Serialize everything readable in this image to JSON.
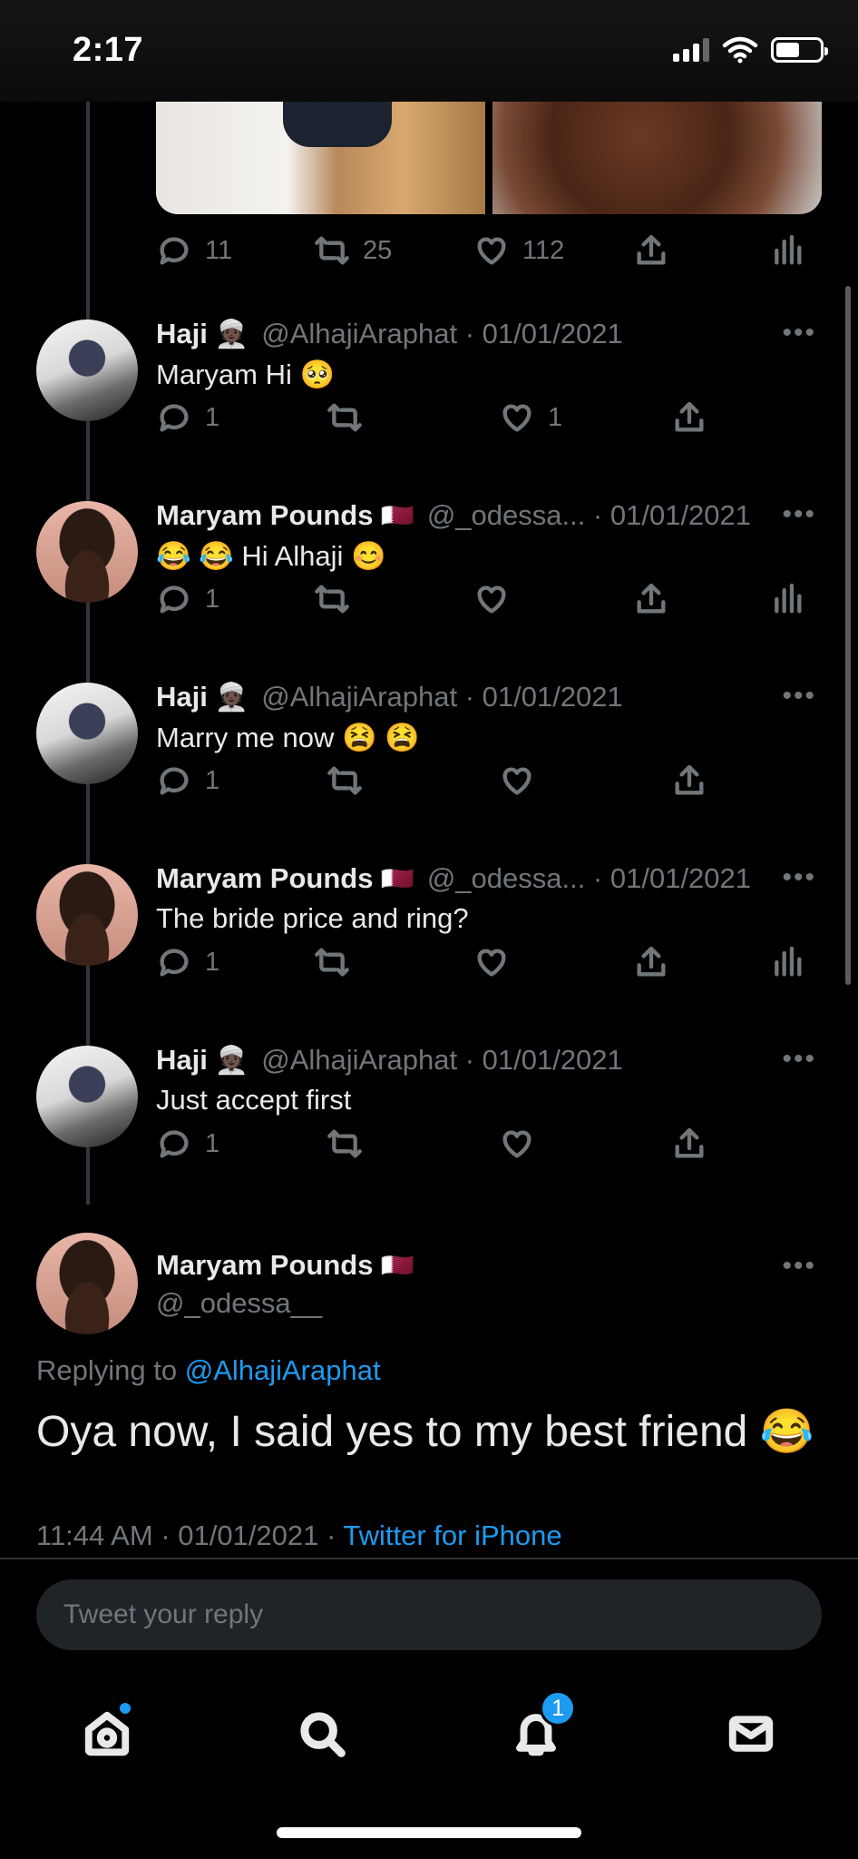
{
  "status_bar": {
    "time": "2:17",
    "battery_level": 0.55
  },
  "top_tweet_actions": {
    "replies": "11",
    "retweets": "25",
    "likes": "112"
  },
  "thread": [
    {
      "name": "Haji",
      "emoji": "👳🏿",
      "handle": "@AlhajiAraphat · 01/01/2021",
      "text": "Maryam Hi 🥺",
      "replies": "1",
      "retweets": "",
      "likes": "1",
      "avatar": "haji"
    },
    {
      "name": "Maryam Pounds",
      "emoji": "🇶🇦",
      "handle": "@_odessa... · 01/01/2021",
      "text": "😂 😂 Hi Alhaji 😊",
      "replies": "1",
      "retweets": "",
      "likes": "",
      "avatar": "maryam"
    },
    {
      "name": "Haji",
      "emoji": "👳🏿",
      "handle": "@AlhajiAraphat · 01/01/2021",
      "text": "Marry me now 😫 😫",
      "replies": "1",
      "retweets": "",
      "likes": "",
      "avatar": "haji"
    },
    {
      "name": "Maryam Pounds",
      "emoji": "🇶🇦",
      "handle": "@_odessa... · 01/01/2021",
      "text": "The bride price and ring?",
      "replies": "1",
      "retweets": "",
      "likes": "",
      "avatar": "maryam"
    },
    {
      "name": "Haji",
      "emoji": "👳🏿",
      "handle": "@AlhajiAraphat · 01/01/2021",
      "text": "Just accept first",
      "replies": "1",
      "retweets": "",
      "likes": "",
      "avatar": "haji"
    }
  ],
  "focus_tweet": {
    "name": "Maryam Pounds",
    "emoji": "🇶🇦",
    "handle": "@_odessa__",
    "replying_prefix": "Replying to",
    "replying_to": "@AlhajiAraphat",
    "text": "Oya now, I said yes to my best friend 😂",
    "timestamp": "11:44 AM · 01/01/2021 · ",
    "source": "Twitter for iPhone"
  },
  "reply_box": {
    "placeholder": "Tweet your reply"
  },
  "tabbar": {
    "notifications_badge": "1"
  },
  "more_label": "•••",
  "colors": {
    "accent": "#1d9bf0",
    "muted": "#71767b",
    "background": "#000000"
  }
}
